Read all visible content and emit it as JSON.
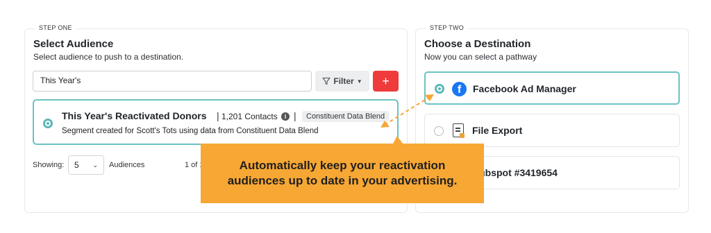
{
  "step_one": {
    "tag": "STEP ONE",
    "title": "Select Audience",
    "subtitle": "Select audience to push to a destination.",
    "search_value": "This Year's",
    "filter_label": "Filter",
    "add_label": "+",
    "audience": {
      "name": "This Year's Reactivated Donors",
      "separator": "|",
      "count": "1,201 Contacts",
      "info": "i",
      "badge": "Constituent Data Blend",
      "description": "Segment created for Scott's Tots using data from Constituent Data Blend"
    },
    "pagination": {
      "showing_label": "Showing:",
      "per_page": "5",
      "unit_label": "Audiences",
      "page_of": "1 of 1"
    }
  },
  "step_two": {
    "tag": "STEP TWO",
    "title": "Choose a Destination",
    "subtitle": "Now you can select a pathway",
    "destinations": [
      {
        "name": "Facebook Ad Manager",
        "icon": "facebook-icon",
        "selected": true
      },
      {
        "name": "File Export",
        "icon": "file-export-icon",
        "selected": false
      },
      {
        "name": "Hubspot #3419654",
        "icon": "hubspot-icon",
        "selected": false
      }
    ]
  },
  "callout": {
    "line1": "Automatically keep your reactivation",
    "line2": "audiences up to date in your advertising."
  },
  "colors": {
    "accent_teal": "#6cc2c3",
    "add_red": "#ef3b3b",
    "callout_orange": "#f7a733",
    "facebook_blue": "#1877f2"
  }
}
